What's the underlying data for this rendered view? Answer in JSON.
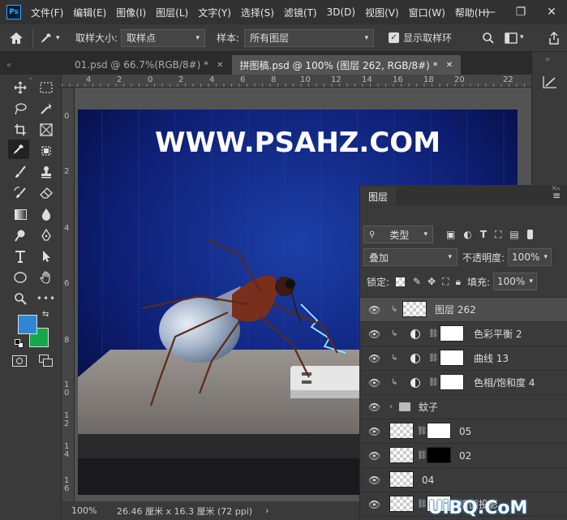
{
  "menubar": {
    "logo": "Ps",
    "items": [
      "文件(F)",
      "编辑(E)",
      "图像(I)",
      "图层(L)",
      "文字(Y)",
      "选择(S)",
      "滤镜(T)",
      "3D(D)",
      "视图(V)",
      "窗口(W)",
      "帮助(H)"
    ],
    "minimize": "—",
    "restore": "❐",
    "close": "✕"
  },
  "options": {
    "sample_size_label": "取样大小:",
    "sample_size_value": "取样点",
    "sample_label": "样本:",
    "sample_value": "所有图层",
    "show_ring_label": "显示取样环"
  },
  "tabs": [
    {
      "label": "01.psd @ 66.7%(RGB/8#) *",
      "close": "✕"
    },
    {
      "label": "拼图稿.psd @ 100% (图层 262, RGB/8#) *",
      "close": "✕"
    }
  ],
  "ruler": {
    "h": [
      "4",
      "2",
      "0",
      "2",
      "4",
      "6",
      "8",
      "10",
      "12",
      "14",
      "16",
      "18",
      "20",
      "22"
    ],
    "v": [
      "0",
      "2",
      "4",
      "6",
      "8",
      "1\n0",
      "1\n2",
      "1\n4",
      "1\n6"
    ]
  },
  "document": {
    "watermark": "WWW.PSAHZ.COM"
  },
  "status": {
    "zoom": "100%",
    "info": "26.46 厘米 x 16.3 厘米 (72 ppi)",
    "arrow": "›"
  },
  "layers_panel": {
    "tab": "图层",
    "filter_kind": "类型",
    "blend_mode": "叠加",
    "opacity_label": "不透明度:",
    "opacity_value": "100%",
    "lock_label": "锁定:",
    "fill_label": "填充:",
    "fill_value": "100%",
    "layers": [
      {
        "name": "图层 262",
        "active": true
      },
      {
        "name": "色彩平衡 2"
      },
      {
        "name": "曲线 13"
      },
      {
        "name": "色相/饱和度 4"
      },
      {
        "name": "蚊子"
      },
      {
        "name": "05"
      },
      {
        "name": "02"
      },
      {
        "name": "04"
      },
      {
        "name": "墙面投影"
      }
    ]
  },
  "colors": {
    "foreground": "#2e86d4",
    "background": "#15a84a",
    "accent": "#31a8ff"
  },
  "watermark_corner": "UiBQ.CoM"
}
